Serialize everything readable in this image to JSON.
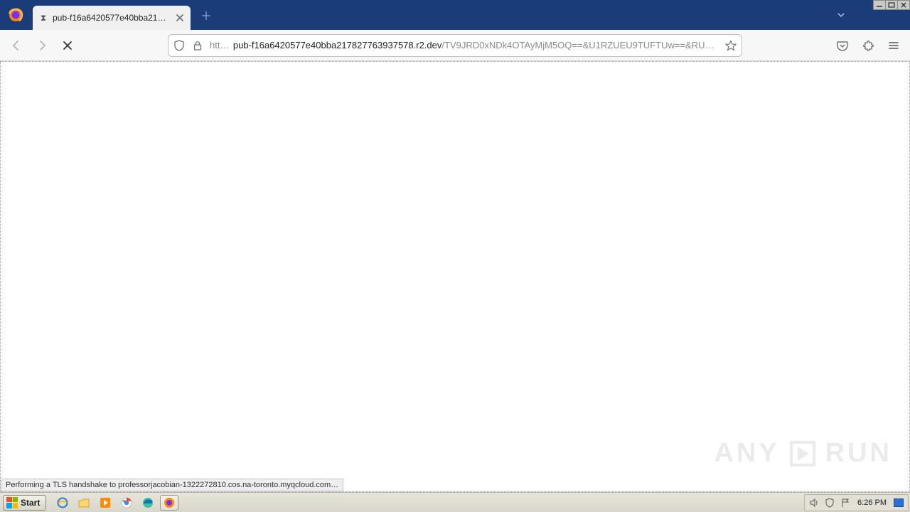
{
  "tab": {
    "title": "pub-f16a6420577e40bba2178277…",
    "loading": true
  },
  "url": {
    "scheme": "https://",
    "host": "pub-f16a6420577e40bba217827763937578.r2.dev",
    "path": "/TV9JRD0xNDk4OTAyMjM5OQ==&U1RZUEU9TUFTUw==&RU1BSUxfSUQ9…"
  },
  "status_text": "Performing a TLS handshake to professorjacobian-1322272810.cos.na-toronto.myqcloud.com…",
  "watermark": {
    "left": "ANY",
    "right": "RUN"
  },
  "taskbar": {
    "start_label": "Start",
    "clock": "6:26 PM"
  }
}
